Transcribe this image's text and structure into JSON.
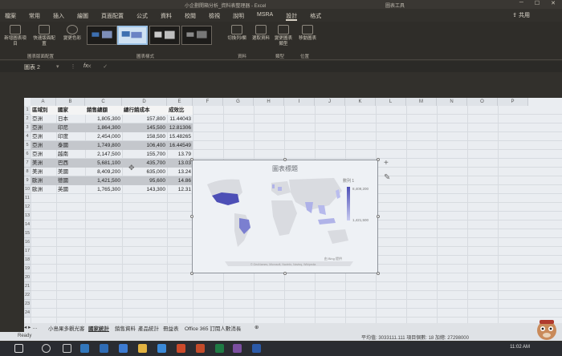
{
  "window": {
    "title": "小企劃開箱分析_資料表整理器 - Excel",
    "tools_title": "圖表工具"
  },
  "tabs": [
    "檔案",
    "常用",
    "插入",
    "繪圖",
    "頁面配置",
    "公式",
    "資料",
    "校閱",
    "檢視",
    "說明",
    "MSRA",
    "設計",
    "格式"
  ],
  "active_tab": "設計",
  "share_label": "共用",
  "ribbon": {
    "buttons": [
      "新增圖表項目",
      "快速版面配置",
      "變更色彩",
      "切換列/欄",
      "選取資料",
      "變更圖表類型",
      "移動圖表"
    ],
    "groups": [
      "圖表版面配置",
      "圖表樣式",
      "資料",
      "類型",
      "位置"
    ]
  },
  "formula_bar": {
    "name_box": "圖表 2",
    "fx": "fx"
  },
  "columns": [
    "A",
    "B",
    "C",
    "D",
    "E",
    "F",
    "G",
    "H",
    "I",
    "J",
    "K",
    "L",
    "M",
    "N",
    "O",
    "P"
  ],
  "rows": [
    "1",
    "2",
    "3",
    "4",
    "5",
    "6",
    "7",
    "8",
    "9",
    "10",
    "11",
    "12",
    "13",
    "14",
    "15",
    "16",
    "17",
    "18",
    "19",
    "20",
    "21",
    "22",
    "23",
    "24"
  ],
  "table": {
    "headers": [
      "區域別",
      "國家",
      "銷售總額",
      "總行銷成本",
      "成效比"
    ],
    "rows": [
      [
        "亞洲",
        "日本",
        "1,805,300",
        "157,800",
        "11.44043"
      ],
      [
        "亞洲",
        "印尼",
        "1,864,300",
        "145,500",
        "12.81306"
      ],
      [
        "亞洲",
        "印度",
        "2,454,000",
        "158,500",
        "15.48265"
      ],
      [
        "亞洲",
        "泰國",
        "1,749,800",
        "106,400",
        "16.44549"
      ],
      [
        "亞洲",
        "越南",
        "2,147,500",
        "155,700",
        "13.79"
      ],
      [
        "美洲",
        "巴西",
        "5,681,100",
        "435,700",
        "13.03"
      ],
      [
        "美洲",
        "美國",
        "8,409,200",
        "635,000",
        "13.24"
      ],
      [
        "歐洲",
        "德國",
        "1,421,500",
        "95,600",
        "14.86"
      ],
      [
        "歐洲",
        "英國",
        "1,765,300",
        "143,300",
        "12.31"
      ]
    ]
  },
  "chart": {
    "title": "圖表標題",
    "legend_series": "數列 1",
    "legend_max": "8,409,200",
    "legend_min": "1,421,500",
    "attribution": "由 Bing 提供",
    "copyright": "© GeoNames, Microsoft, Navinfo, Navteq, Wikipedia",
    "colors": {
      "high": "#4d4fb6",
      "low": "#c8cbf0",
      "land": "#d9dbe0"
    }
  },
  "sheet_tabs": [
    "小島果多觀光客",
    "國家統計",
    "銷售資料",
    "產品統計",
    "冊益表",
    "Office 365 訂閱人數消長"
  ],
  "active_sheet": "國家統計",
  "status": {
    "ready": "Ready",
    "stats": "平均值: 3033111.111   項目個數: 18   加總: 27298000"
  },
  "clock": "11:02 AM"
}
